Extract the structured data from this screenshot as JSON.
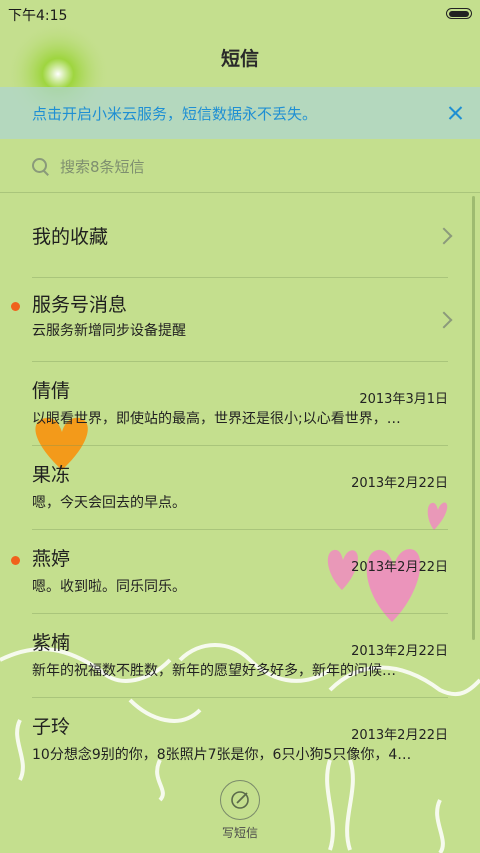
{
  "status_bar": {
    "time": "下午4:15"
  },
  "header": {
    "title": "短信"
  },
  "banner": {
    "text": "点击开启小米云服务，短信数据永不丢失。"
  },
  "search": {
    "placeholder": "搜索8条短信"
  },
  "rows": [
    {
      "name": "我的收藏",
      "preview": "",
      "date": "",
      "unread": false,
      "chevron": true
    },
    {
      "name": "服务号消息",
      "preview": "云服务新增同步设备提醒",
      "date": "",
      "unread": true,
      "chevron": true
    },
    {
      "name": "倩倩",
      "preview": "以眼看世界，即使站的最高，世界还是很小;以心看世界，…",
      "date": "2013年3月1日",
      "unread": false,
      "chevron": false
    },
    {
      "name": "果冻",
      "preview": "嗯，今天会回去的早点。",
      "date": "2013年2月22日",
      "unread": false,
      "chevron": false
    },
    {
      "name": "燕婷",
      "preview": "嗯。收到啦。同乐同乐。",
      "date": "2013年2月22日",
      "unread": true,
      "chevron": false
    },
    {
      "name": "紫楠",
      "preview": "新年的祝福数不胜数，新年的愿望好多好多，新年的问候…",
      "date": "2013年2月22日",
      "unread": false,
      "chevron": false
    },
    {
      "name": "子玲",
      "preview": "10分想念9别的你，8张照片7张是你，6只小狗5只像你，4…",
      "date": "2013年2月22日",
      "unread": false,
      "chevron": false
    }
  ],
  "compose": {
    "label": "写短信"
  },
  "colors": {
    "accent": "#1f8fd3",
    "unread": "#f0611c",
    "background": "#c4df8e"
  }
}
